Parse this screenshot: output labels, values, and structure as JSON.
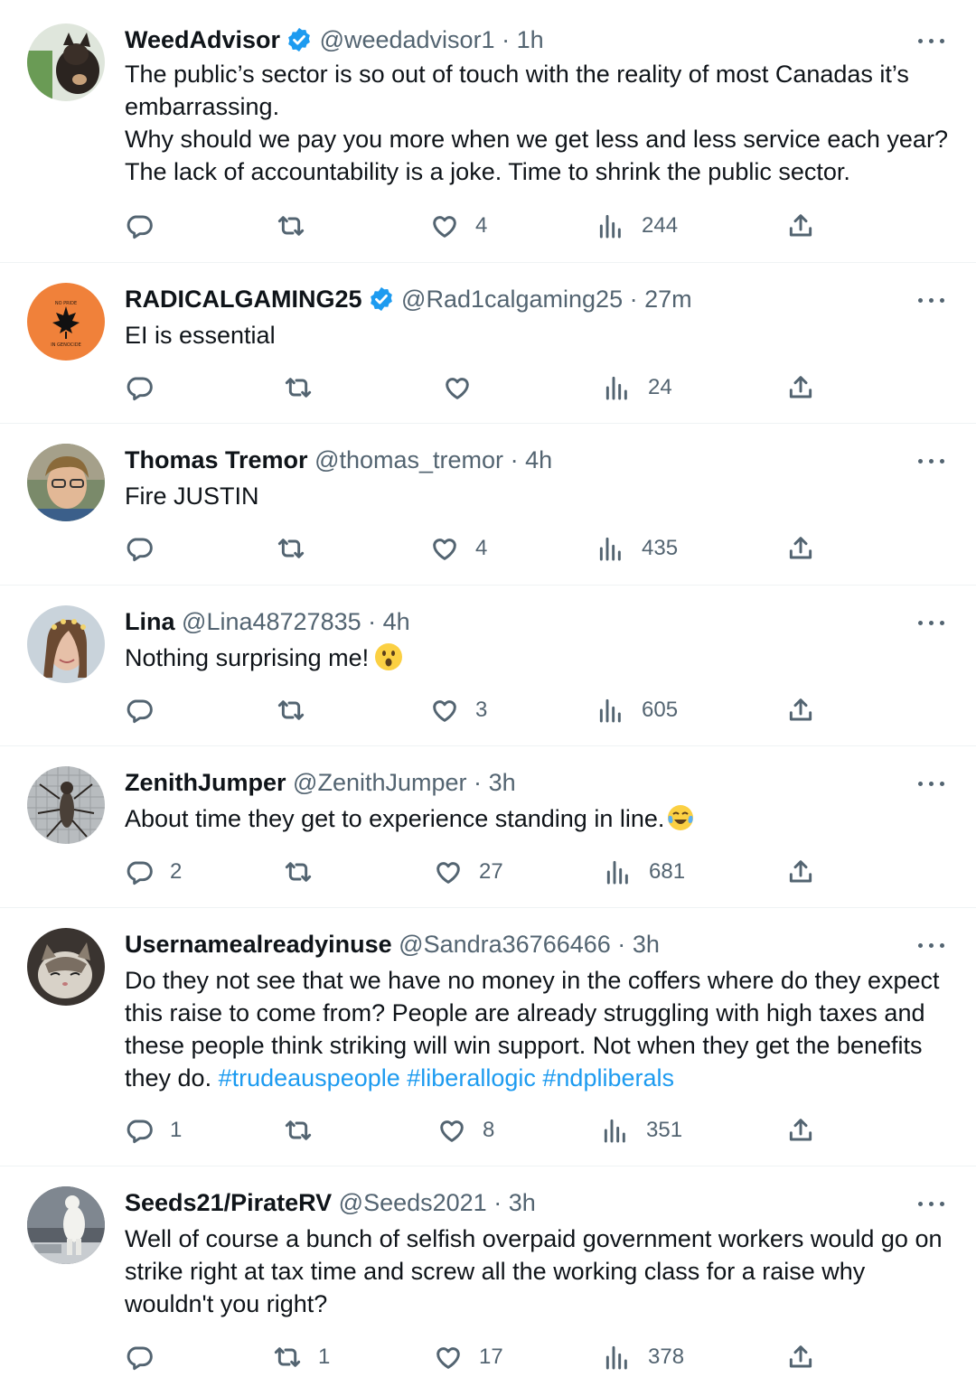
{
  "tweets": [
    {
      "name": "WeedAdvisor",
      "verified": true,
      "handle": "@weedadvisor1",
      "separator": "·",
      "time": "1h",
      "text": "The public’s sector is so out of touch with the reality of most Canadas it’s embarrassing.\nWhy should we pay you more when we get less and less service each year? The lack of accountability is a joke. Time to shrink the public sector.",
      "replies": "",
      "retweets": "",
      "likes": "4",
      "views": "244"
    },
    {
      "name": "RADICALGAMING25",
      "verified": true,
      "handle": "@Rad1calgaming25",
      "separator": "·",
      "time": "27m",
      "text": "EI is essential",
      "replies": "",
      "retweets": "",
      "likes": "",
      "views": "24"
    },
    {
      "name": "Thomas Tremor",
      "verified": false,
      "handle": "@thomas_tremor",
      "separator": "·",
      "time": "4h",
      "text": "Fire JUSTIN",
      "replies": "",
      "retweets": "",
      "likes": "4",
      "views": "435"
    },
    {
      "name": "Lina",
      "verified": false,
      "handle": "@Lina48727835",
      "separator": "·",
      "time": "4h",
      "text": "Nothing surprising me!",
      "emoji": "astonished-face-emoji",
      "replies": "",
      "retweets": "",
      "likes": "3",
      "views": "605"
    },
    {
      "name": "ZenithJumper",
      "verified": false,
      "handle": "@ZenithJumper",
      "separator": "·",
      "time": "3h",
      "text": "About time they get to experience standing in line.",
      "emoji": "tears-of-joy-emoji",
      "replies": "2",
      "retweets": "",
      "likes": "27",
      "views": "681"
    },
    {
      "name": "Usernamealreadyinuse",
      "verified": false,
      "handle": "@Sandra36766466",
      "separator": "·",
      "time": "3h",
      "text": "Do they not see that we have no money in the coffers where do they expect this raise to come from? People are already struggling with high taxes and these people think striking will win support. Not when they get the benefits they do.",
      "hashtags": [
        "#trudeauspeople",
        "#liberallogic",
        "#ndpliberals"
      ],
      "replies": "1",
      "retweets": "",
      "likes": "8",
      "views": "351"
    },
    {
      "name": "Seeds21/PirateRV",
      "verified": false,
      "handle": "@Seeds2021",
      "separator": "·",
      "time": "3h",
      "text": "Well of course a bunch of selfish overpaid government workers would go on strike right at tax time and screw all the working class for a raise why wouldn't you right?",
      "replies": "",
      "retweets": "1",
      "likes": "17",
      "views": "378"
    }
  ],
  "icons": {
    "reply": "reply-icon",
    "retweet": "retweet-icon",
    "like": "heart-icon",
    "views": "views-icon",
    "share": "share-icon",
    "more": "more-icon",
    "verified": "verified-badge-icon"
  },
  "colors": {
    "text": "#0f1419",
    "secondary": "#536471",
    "link": "#1d9bf0",
    "verified": "#1d9bf0",
    "divider": "#eff3f4"
  }
}
